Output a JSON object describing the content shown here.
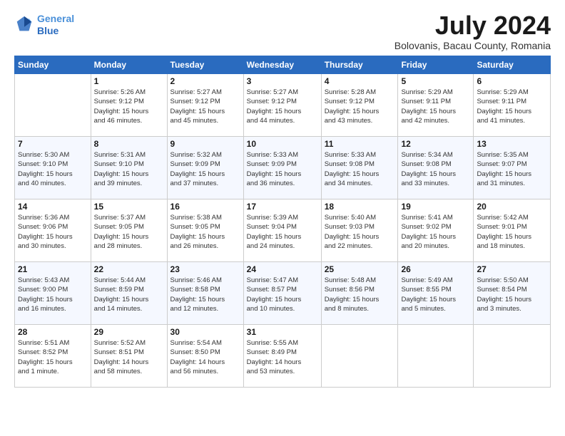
{
  "header": {
    "logo_line1": "General",
    "logo_line2": "Blue",
    "title": "July 2024",
    "location": "Bolovanis, Bacau County, Romania"
  },
  "weekdays": [
    "Sunday",
    "Monday",
    "Tuesday",
    "Wednesday",
    "Thursday",
    "Friday",
    "Saturday"
  ],
  "weeks": [
    [
      {
        "day": "",
        "info": ""
      },
      {
        "day": "1",
        "info": "Sunrise: 5:26 AM\nSunset: 9:12 PM\nDaylight: 15 hours\nand 46 minutes."
      },
      {
        "day": "2",
        "info": "Sunrise: 5:27 AM\nSunset: 9:12 PM\nDaylight: 15 hours\nand 45 minutes."
      },
      {
        "day": "3",
        "info": "Sunrise: 5:27 AM\nSunset: 9:12 PM\nDaylight: 15 hours\nand 44 minutes."
      },
      {
        "day": "4",
        "info": "Sunrise: 5:28 AM\nSunset: 9:12 PM\nDaylight: 15 hours\nand 43 minutes."
      },
      {
        "day": "5",
        "info": "Sunrise: 5:29 AM\nSunset: 9:11 PM\nDaylight: 15 hours\nand 42 minutes."
      },
      {
        "day": "6",
        "info": "Sunrise: 5:29 AM\nSunset: 9:11 PM\nDaylight: 15 hours\nand 41 minutes."
      }
    ],
    [
      {
        "day": "7",
        "info": "Sunrise: 5:30 AM\nSunset: 9:10 PM\nDaylight: 15 hours\nand 40 minutes."
      },
      {
        "day": "8",
        "info": "Sunrise: 5:31 AM\nSunset: 9:10 PM\nDaylight: 15 hours\nand 39 minutes."
      },
      {
        "day": "9",
        "info": "Sunrise: 5:32 AM\nSunset: 9:09 PM\nDaylight: 15 hours\nand 37 minutes."
      },
      {
        "day": "10",
        "info": "Sunrise: 5:33 AM\nSunset: 9:09 PM\nDaylight: 15 hours\nand 36 minutes."
      },
      {
        "day": "11",
        "info": "Sunrise: 5:33 AM\nSunset: 9:08 PM\nDaylight: 15 hours\nand 34 minutes."
      },
      {
        "day": "12",
        "info": "Sunrise: 5:34 AM\nSunset: 9:08 PM\nDaylight: 15 hours\nand 33 minutes."
      },
      {
        "day": "13",
        "info": "Sunrise: 5:35 AM\nSunset: 9:07 PM\nDaylight: 15 hours\nand 31 minutes."
      }
    ],
    [
      {
        "day": "14",
        "info": "Sunrise: 5:36 AM\nSunset: 9:06 PM\nDaylight: 15 hours\nand 30 minutes."
      },
      {
        "day": "15",
        "info": "Sunrise: 5:37 AM\nSunset: 9:05 PM\nDaylight: 15 hours\nand 28 minutes."
      },
      {
        "day": "16",
        "info": "Sunrise: 5:38 AM\nSunset: 9:05 PM\nDaylight: 15 hours\nand 26 minutes."
      },
      {
        "day": "17",
        "info": "Sunrise: 5:39 AM\nSunset: 9:04 PM\nDaylight: 15 hours\nand 24 minutes."
      },
      {
        "day": "18",
        "info": "Sunrise: 5:40 AM\nSunset: 9:03 PM\nDaylight: 15 hours\nand 22 minutes."
      },
      {
        "day": "19",
        "info": "Sunrise: 5:41 AM\nSunset: 9:02 PM\nDaylight: 15 hours\nand 20 minutes."
      },
      {
        "day": "20",
        "info": "Sunrise: 5:42 AM\nSunset: 9:01 PM\nDaylight: 15 hours\nand 18 minutes."
      }
    ],
    [
      {
        "day": "21",
        "info": "Sunrise: 5:43 AM\nSunset: 9:00 PM\nDaylight: 15 hours\nand 16 minutes."
      },
      {
        "day": "22",
        "info": "Sunrise: 5:44 AM\nSunset: 8:59 PM\nDaylight: 15 hours\nand 14 minutes."
      },
      {
        "day": "23",
        "info": "Sunrise: 5:46 AM\nSunset: 8:58 PM\nDaylight: 15 hours\nand 12 minutes."
      },
      {
        "day": "24",
        "info": "Sunrise: 5:47 AM\nSunset: 8:57 PM\nDaylight: 15 hours\nand 10 minutes."
      },
      {
        "day": "25",
        "info": "Sunrise: 5:48 AM\nSunset: 8:56 PM\nDaylight: 15 hours\nand 8 minutes."
      },
      {
        "day": "26",
        "info": "Sunrise: 5:49 AM\nSunset: 8:55 PM\nDaylight: 15 hours\nand 5 minutes."
      },
      {
        "day": "27",
        "info": "Sunrise: 5:50 AM\nSunset: 8:54 PM\nDaylight: 15 hours\nand 3 minutes."
      }
    ],
    [
      {
        "day": "28",
        "info": "Sunrise: 5:51 AM\nSunset: 8:52 PM\nDaylight: 15 hours\nand 1 minute."
      },
      {
        "day": "29",
        "info": "Sunrise: 5:52 AM\nSunset: 8:51 PM\nDaylight: 14 hours\nand 58 minutes."
      },
      {
        "day": "30",
        "info": "Sunrise: 5:54 AM\nSunset: 8:50 PM\nDaylight: 14 hours\nand 56 minutes."
      },
      {
        "day": "31",
        "info": "Sunrise: 5:55 AM\nSunset: 8:49 PM\nDaylight: 14 hours\nand 53 minutes."
      },
      {
        "day": "",
        "info": ""
      },
      {
        "day": "",
        "info": ""
      },
      {
        "day": "",
        "info": ""
      }
    ]
  ]
}
